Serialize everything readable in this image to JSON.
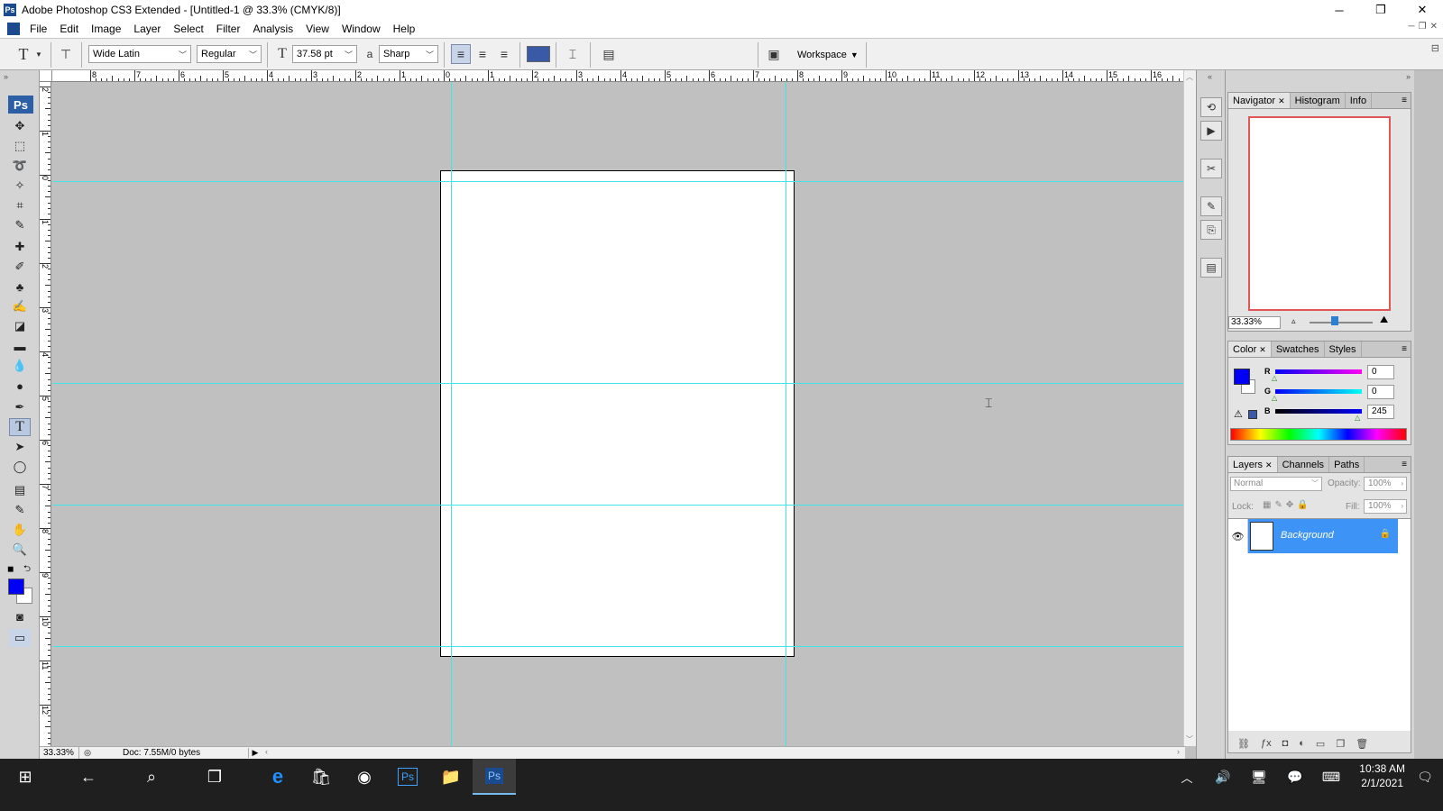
{
  "window": {
    "app_icon": "Ps",
    "title": "Adobe Photoshop CS3 Extended - [Untitled-1 @ 33.3% (CMYK/8)]",
    "minimize": "─",
    "restore": "❐",
    "close": "✕"
  },
  "menu": [
    "File",
    "Edit",
    "Image",
    "Layer",
    "Select",
    "Filter",
    "Analysis",
    "View",
    "Window",
    "Help"
  ],
  "options_bar": {
    "tool_glyph": "T",
    "font_family": "Wide Latin",
    "font_style": "Regular",
    "font_size": "37.58 pt",
    "aa_label": "a",
    "antialias": "Sharp",
    "text_color": "#3a5aa8",
    "workspace": "Workspace"
  },
  "tools": {
    "ps_logo": "Ps",
    "foreground_color": "#0000f5",
    "background_color": "#ffffff"
  },
  "rulers": {
    "top": [
      "8",
      "7",
      "6",
      "5",
      "4",
      "3",
      "2",
      "1",
      "0",
      "1",
      "2",
      "3",
      "4",
      "5",
      "6",
      "7",
      "8",
      "9",
      "10",
      "11",
      "12",
      "13",
      "14",
      "15",
      "16"
    ],
    "left": [
      "2",
      "1",
      "0",
      "1",
      "2",
      "3",
      "4",
      "5",
      "6",
      "7",
      "8",
      "9",
      "10",
      "11",
      "12"
    ]
  },
  "status": {
    "zoom": "33.33%",
    "doc": "Doc: 7.55M/0 bytes"
  },
  "navigator": {
    "tabs": [
      "Navigator",
      "Histogram",
      "Info"
    ],
    "zoom": "33.33%"
  },
  "color_panel": {
    "tabs": [
      "Color",
      "Swatches",
      "Styles"
    ],
    "r_label": "R",
    "g_label": "G",
    "b_label": "B",
    "r": "0",
    "g": "0",
    "b": "245",
    "fg": "#0000f5",
    "r_level": 0,
    "g_level": 0,
    "b_level": 0.96
  },
  "layers_panel": {
    "tabs": [
      "Layers",
      "Channels",
      "Paths"
    ],
    "blend_mode": "Normal",
    "opacity_label": "Opacity:",
    "opacity": "100%",
    "lock_label": "Lock:",
    "fill_label": "Fill:",
    "fill": "100%",
    "layer_name": "Background"
  },
  "taskbar": {
    "time": "10:38 AM",
    "date": "2/1/2021",
    "ps_label": "Ps"
  }
}
